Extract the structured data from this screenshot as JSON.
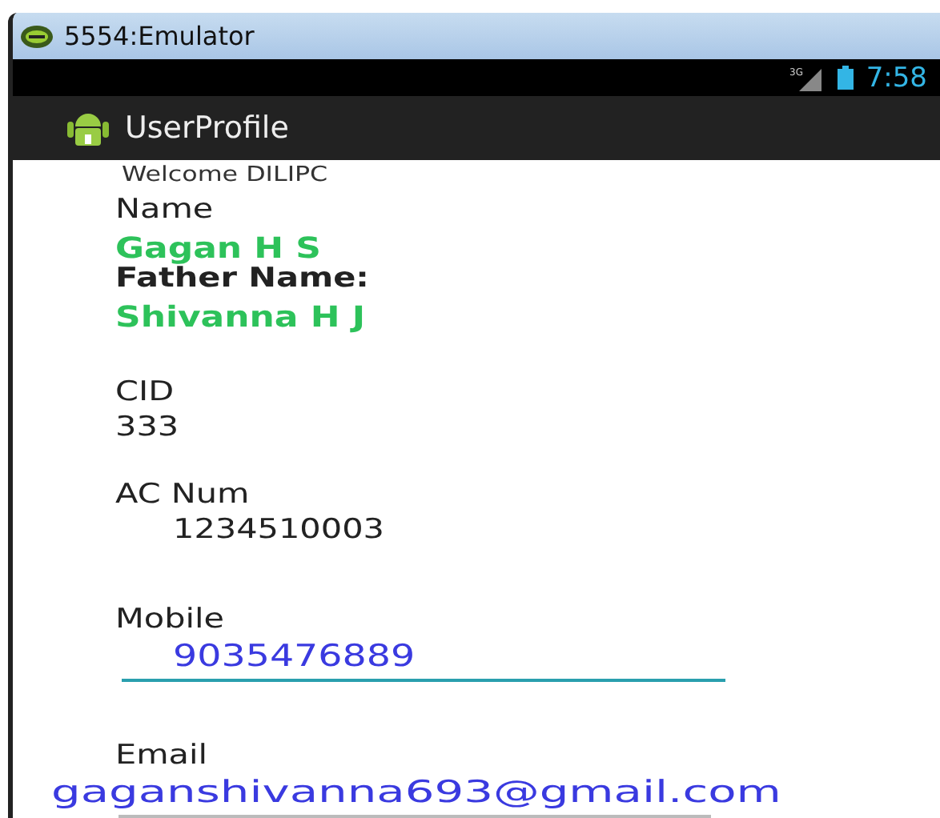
{
  "window": {
    "title": "5554:Emulator"
  },
  "status_bar": {
    "network": "3G",
    "time": "7:58"
  },
  "action_bar": {
    "title": "UserProfile"
  },
  "welcome": "Welcome DILIPC",
  "fields": [
    {
      "kind": "name",
      "label": "Name",
      "value": "Gagan H S"
    },
    {
      "kind": "name",
      "label": "Father Name:",
      "value": "Shivanna H J"
    },
    {
      "kind": "plain",
      "label": "CID",
      "value": "333"
    },
    {
      "kind": "indented",
      "label": "AC Num",
      "value": "1234510003"
    },
    {
      "kind": "edit",
      "label": "Mobile",
      "value": "9035476889",
      "focused": true
    },
    {
      "kind": "edit",
      "label": "Email",
      "value": "gaganshivanna693@gmail.com",
      "focused": false
    }
  ]
}
